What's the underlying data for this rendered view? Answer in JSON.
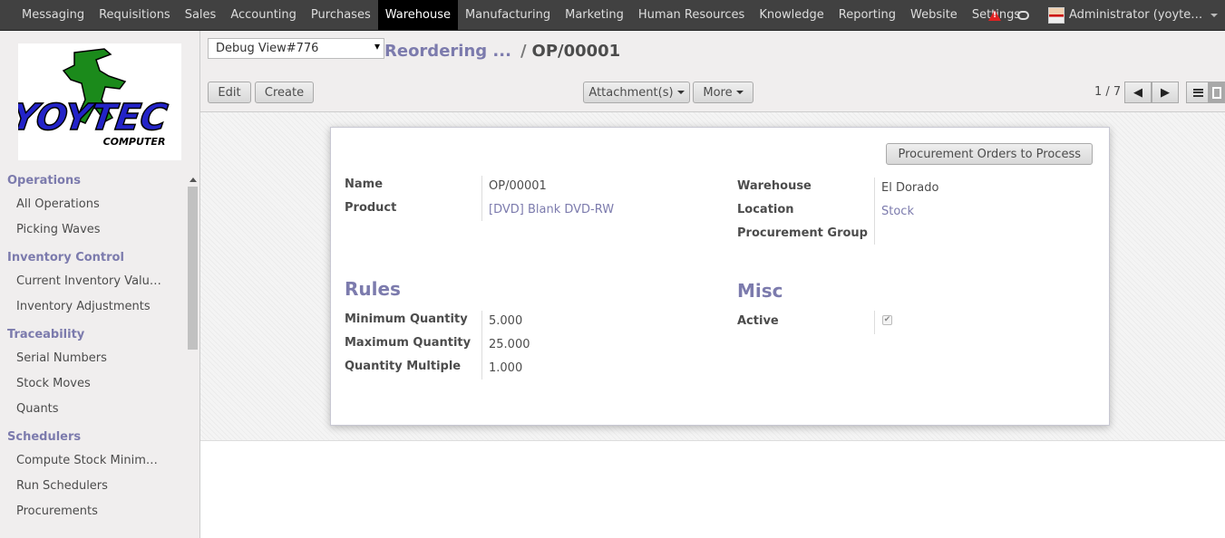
{
  "topbar": {
    "menu": [
      "Messaging",
      "Requisitions",
      "Sales",
      "Accounting",
      "Purchases",
      "Warehouse",
      "Manufacturing",
      "Marketing",
      "Human Resources",
      "Knowledge",
      "Reporting",
      "Website",
      "Settings"
    ],
    "active": "Warehouse",
    "user": "Administrator (yoytec_d..."
  },
  "sidebar": {
    "logo_text": "YOYTEC",
    "logo_subtext": "COMPUTER",
    "sections": [
      {
        "title": "Operations",
        "items": [
          "All Operations",
          "Picking Waves"
        ]
      },
      {
        "title": "Inventory Control",
        "items": [
          "Current Inventory Valuat...",
          "Inventory Adjustments"
        ]
      },
      {
        "title": "Traceability",
        "items": [
          "Serial Numbers",
          "Stock Moves",
          "Quants"
        ]
      },
      {
        "title": "Schedulers",
        "items": [
          "Compute Stock Minimu...",
          "Run Schedulers",
          "Procurements"
        ]
      }
    ]
  },
  "control_panel": {
    "debug_view": "Debug View#776",
    "breadcrumb_parent": "Reordering ...",
    "breadcrumb_sep": "/",
    "breadcrumb_current": "OP/00001",
    "edit_label": "Edit",
    "create_label": "Create",
    "attachments_label": "Attachment(s)",
    "more_label": "More",
    "pager": "1 / 7"
  },
  "form": {
    "procurement_button": "Procurement Orders to Process",
    "name_label": "Name",
    "name_value": "OP/00001",
    "product_label": "Product",
    "product_value": "[DVD] Blank DVD-RW",
    "warehouse_label": "Warehouse",
    "warehouse_value": "El Dorado",
    "location_label": "Location",
    "location_value": "Stock",
    "group_label": "Procurement Group",
    "rules_title": "Rules",
    "min_label": "Minimum Quantity",
    "min_value": "5.000",
    "max_label": "Maximum Quantity",
    "max_value": "25.000",
    "multiple_label": "Quantity Multiple",
    "multiple_value": "1.000",
    "misc_title": "Misc",
    "active_label": "Active",
    "active_checked": true
  }
}
